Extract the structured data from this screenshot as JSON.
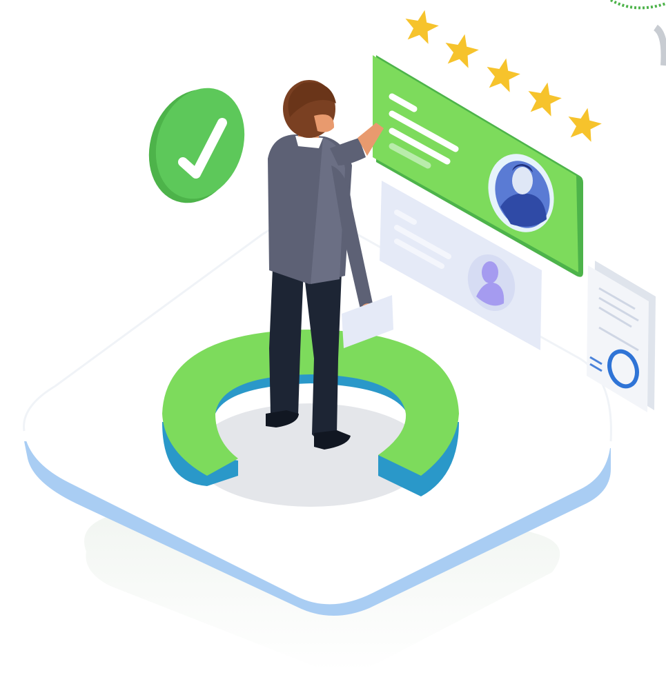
{
  "illustration": {
    "rating": {
      "value": 5,
      "max": 5,
      "icon": "star-icon",
      "color": "#f6c32c"
    },
    "approval_badge": {
      "icon": "checkmark-icon",
      "color": "#5dc85a"
    },
    "candidate_cards": [
      {
        "state": "selected",
        "color": "#7ddb5c",
        "icon": "person-avatar-icon"
      },
      {
        "state": "inactive",
        "color": "#e5eaf7",
        "icon": "person-silhouette-icon"
      }
    ],
    "document": {
      "icon": "report-document-icon"
    },
    "colors": {
      "green": "#7ddb5c",
      "dark_green": "#4db34a",
      "blue": "#2a98c9",
      "platform_edge": "#a9cdf3",
      "suit": "#5d6175",
      "trousers": "#1d2534",
      "hair": "#7a4022",
      "skin": "#e89a6e",
      "star": "#f6c32c"
    }
  }
}
